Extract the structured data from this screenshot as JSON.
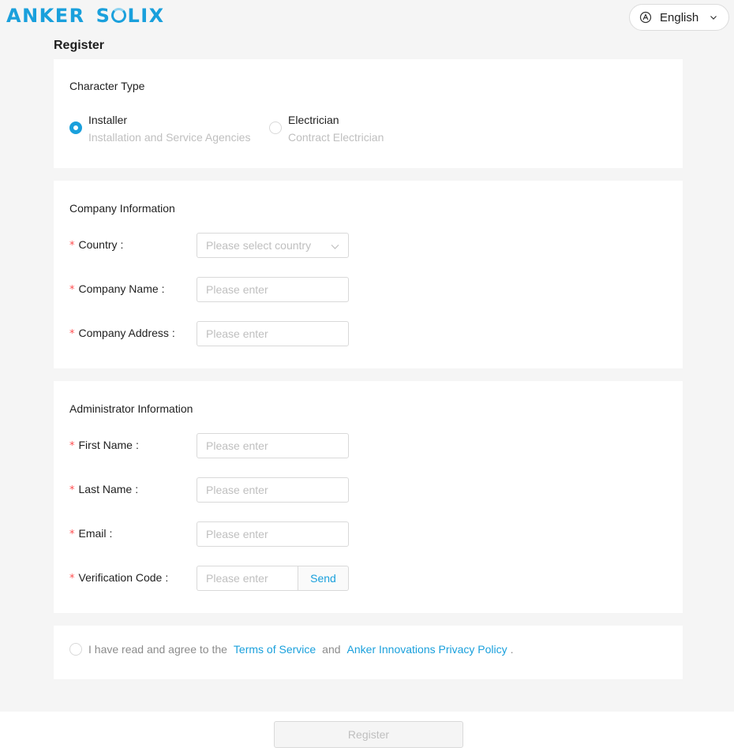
{
  "brand": {
    "logo_left": "ANKER",
    "logo_right_s": "S",
    "logo_right_rest": "LIX"
  },
  "language": {
    "label": "English"
  },
  "page": {
    "title": "Register"
  },
  "character_type": {
    "title": "Character Type",
    "options": [
      {
        "label": "Installer",
        "sublabel": "Installation and Service Agencies",
        "selected": true
      },
      {
        "label": "Electrician",
        "sublabel": "Contract Electrician",
        "selected": false
      }
    ]
  },
  "company": {
    "title": "Company Information",
    "country": {
      "label": "Country",
      "placeholder": "Please select country"
    },
    "company_name": {
      "label": "Company Name",
      "placeholder": "Please enter"
    },
    "company_address": {
      "label": "Company Address",
      "placeholder": "Please enter"
    }
  },
  "admin": {
    "title": "Administrator Information",
    "first_name": {
      "label": "First Name",
      "placeholder": "Please enter"
    },
    "last_name": {
      "label": "Last Name",
      "placeholder": "Please enter"
    },
    "email": {
      "label": "Email",
      "placeholder": "Please enter"
    },
    "verification_code": {
      "label": "Verification Code",
      "placeholder": "Please enter",
      "send_label": "Send"
    }
  },
  "agreement": {
    "prefix": "I have read and agree to the",
    "terms_link": "Terms of Service",
    "and": "and",
    "privacy_link": "Anker Innovations Privacy Policy",
    "suffix": ".",
    "checked": false
  },
  "common": {
    "required_mark": "*",
    "colon": ":"
  },
  "footer": {
    "register_label": "Register"
  },
  "colors": {
    "accent": "#1aa0dc",
    "required": "#ff4d4f",
    "placeholder": "#bfbfbf"
  },
  "icons": {
    "language": "globe-icon",
    "dropdown": "chevron-down-icon"
  }
}
